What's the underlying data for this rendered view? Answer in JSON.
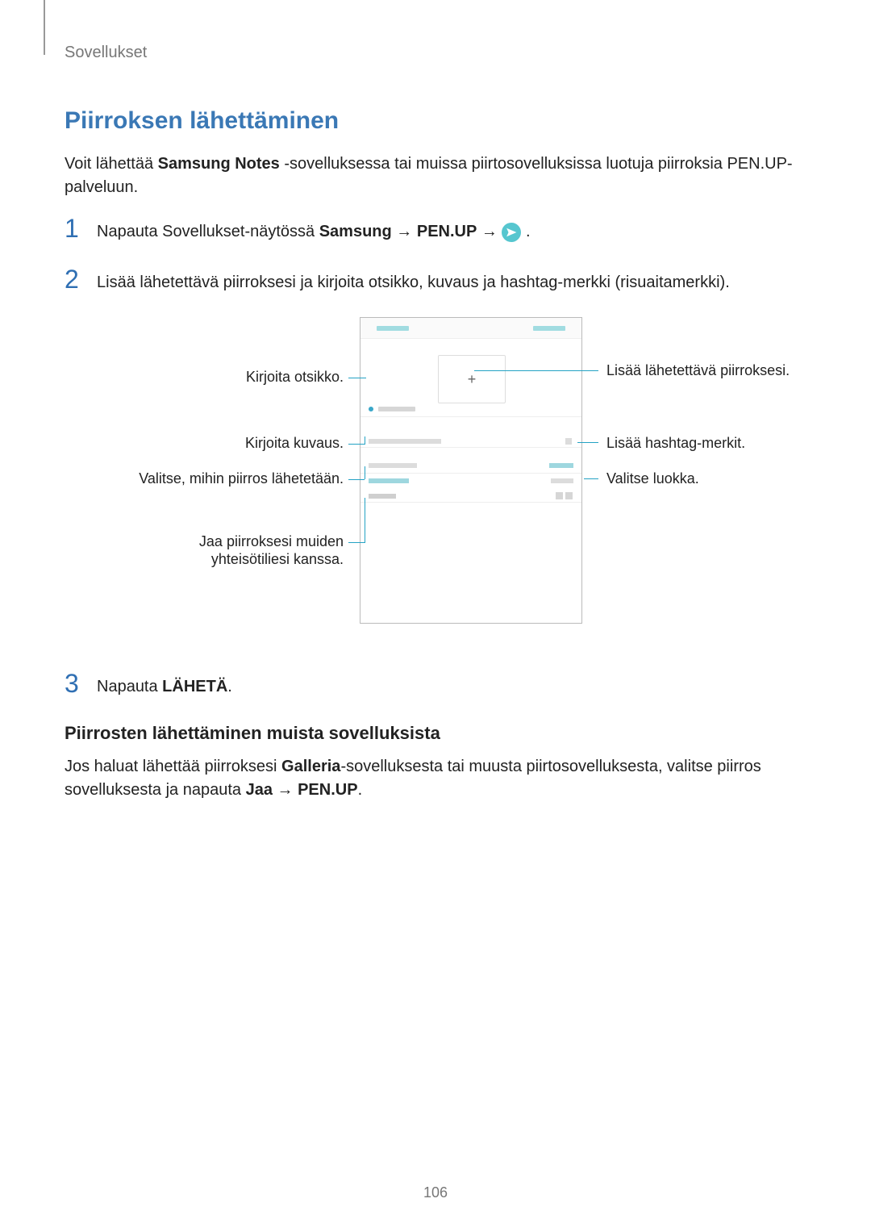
{
  "header": {
    "section": "Sovellukset"
  },
  "h1": "Piirroksen lähettäminen",
  "intro": {
    "pre": "Voit lähettää ",
    "bold": "Samsung Notes",
    "post": " -sovelluksessa tai muissa piirtosovelluksissa luotuja piirroksia PEN.UP-palveluun."
  },
  "steps": {
    "1": {
      "pre": "Napauta Sovellukset-näytössä ",
      "b1": "Samsung",
      "arrow": " → ",
      "b2": "PEN.UP",
      "post": " ."
    },
    "2": "Lisää lähetettävä piirroksesi ja kirjoita otsikko, kuvaus ja hashtag-merkki (risuaitamerkki).",
    "3": {
      "pre": "Napauta ",
      "bold": "LÄHETÄ",
      "post": "."
    }
  },
  "callouts": {
    "left": {
      "title": "Kirjoita otsikko.",
      "desc": "Kirjoita kuvaus.",
      "collection": "Valitse, mihin piirros lähetetään.",
      "share1": "Jaa piirroksesi muiden",
      "share2": "yhteisötiliesi kanssa."
    },
    "right": {
      "add": "Lisää lähetettävä piirroksesi.",
      "hashtag": "Lisää hashtag-merkit.",
      "category": "Valitse luokka."
    }
  },
  "phone": {
    "plus": "+"
  },
  "subsection": {
    "h2": "Piirrosten lähettäminen muista sovelluksista",
    "p": {
      "pre": "Jos haluat lähettää piirroksesi ",
      "b1": "Galleria",
      "mid": "-sovelluksesta tai muusta piirtosovelluksesta, valitse piirros sovelluksesta ja napauta ",
      "b2": "Jaa",
      "arrow": " → ",
      "b3": "PEN.UP",
      "post": "."
    }
  },
  "page_number": "106"
}
